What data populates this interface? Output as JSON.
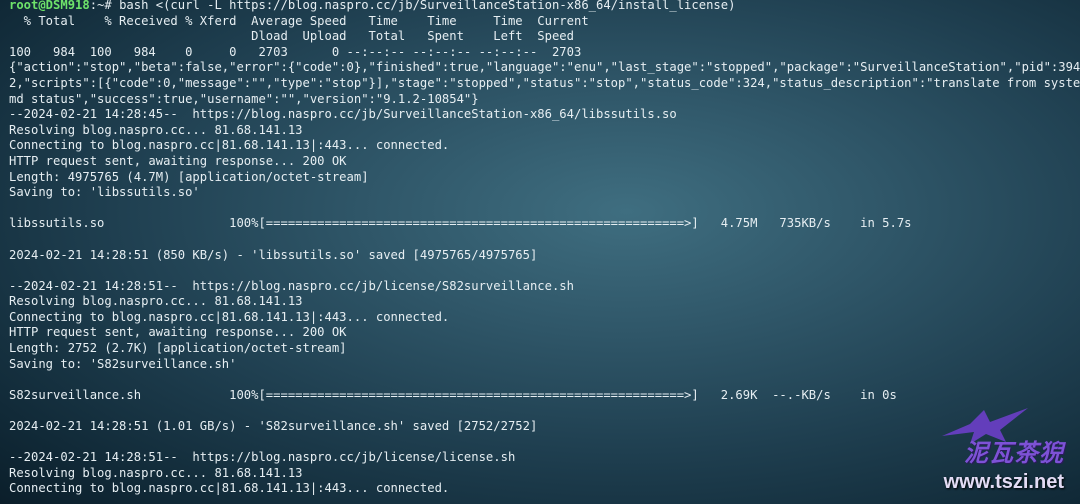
{
  "terminal": {
    "prompt_user": "root@DSM918",
    "prompt_tail": ":~# bash <(curl -L https://blog.naspro.cc/jb/SurveillanceStation-x86_64/install_license)",
    "lines": [
      "  % Total    % Received % Xferd  Average Speed   Time    Time     Time  Current",
      "                                 Dload  Upload   Total   Spent    Left  Speed",
      "100   984  100   984    0     0   2703      0 --:--:-- --:--:-- --:--:--  2703",
      "{\"action\":\"stop\",\"beta\":false,\"error\":{\"code\":0},\"finished\":true,\"language\":\"enu\",\"last_stage\":\"stopped\",\"package\":\"SurveillanceStation\",\"pid\":394",
      "2,\"scripts\":[{\"code\":0,\"message\":\"\",\"type\":\"stop\"}],\"stage\":\"stopped\",\"status\":\"stop\",\"status_code\":324,\"status_description\":\"translate from syste",
      "md status\",\"success\":true,\"username\":\"\",\"version\":\"9.1.2-10854\"}",
      "--2024-02-21 14:28:45--  https://blog.naspro.cc/jb/SurveillanceStation-x86_64/libssutils.so",
      "Resolving blog.naspro.cc... 81.68.141.13",
      "Connecting to blog.naspro.cc|81.68.141.13|:443... connected.",
      "HTTP request sent, awaiting response... 200 OK",
      "Length: 4975765 (4.7M) [application/octet-stream]",
      "Saving to: 'libssutils.so'",
      "",
      "libssutils.so                 100%[=========================================================>]   4.75M   735KB/s    in 5.7s",
      "",
      "2024-02-21 14:28:51 (850 KB/s) - 'libssutils.so' saved [4975765/4975765]",
      "",
      "--2024-02-21 14:28:51--  https://blog.naspro.cc/jb/license/S82surveillance.sh",
      "Resolving blog.naspro.cc... 81.68.141.13",
      "Connecting to blog.naspro.cc|81.68.141.13|:443... connected.",
      "HTTP request sent, awaiting response... 200 OK",
      "Length: 2752 (2.7K) [application/octet-stream]",
      "Saving to: 'S82surveillance.sh'",
      "",
      "S82surveillance.sh            100%[=========================================================>]   2.69K  --.-KB/s    in 0s",
      "",
      "2024-02-21 14:28:51 (1.01 GB/s) - 'S82surveillance.sh' saved [2752/2752]",
      "",
      "--2024-02-21 14:28:51--  https://blog.naspro.cc/jb/license/license.sh",
      "Resolving blog.naspro.cc... 81.68.141.13",
      "Connecting to blog.naspro.cc|81.68.141.13|:443... connected."
    ]
  },
  "watermark": {
    "name": "泥瓦茶猊",
    "url": "www.tszi.net",
    "icon": "bird-silhouette-icon",
    "colors": {
      "name": "#7d52d6",
      "url": "#e3dcf5"
    }
  },
  "colors": {
    "prompt_user": "#6ee36a",
    "text": "#e6eef2",
    "background_center": "#3f6e80",
    "background_edge": "#0b1e2a"
  }
}
